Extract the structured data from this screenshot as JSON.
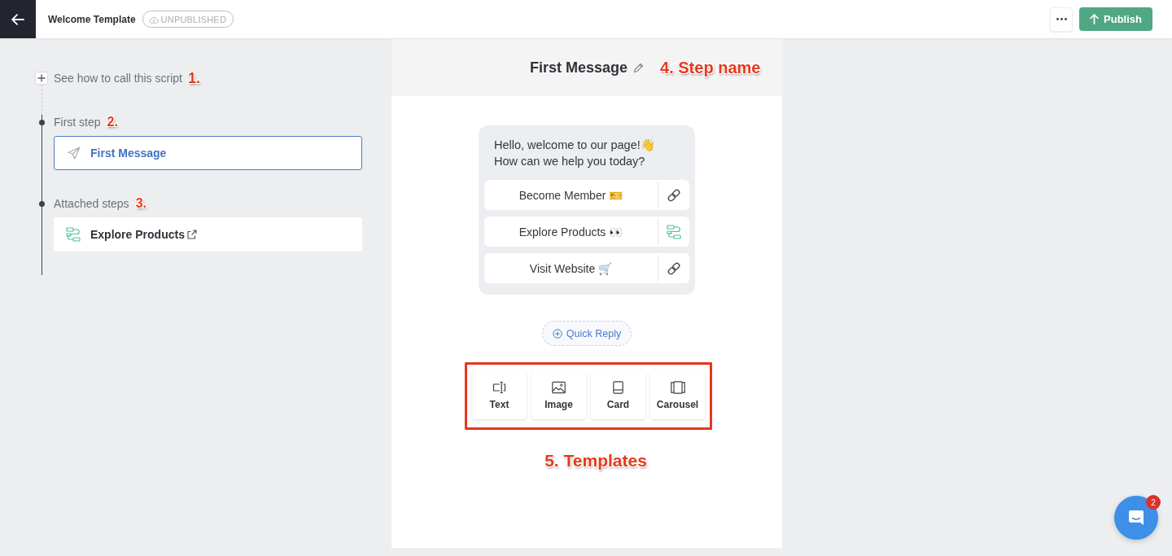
{
  "topbar": {
    "title": "Welcome Template",
    "status": "UNPUBLISHED",
    "publish_button": "Publish"
  },
  "sidebar": {
    "script_link": {
      "label": "See how to call this script",
      "annotation": "1."
    },
    "sections": [
      {
        "heading": "First step",
        "annotation": "2.",
        "steps": [
          {
            "name": "First Message",
            "kind": "message",
            "selected": true,
            "external": false
          }
        ]
      },
      {
        "heading": "Attached steps",
        "annotation": "3.",
        "steps": [
          {
            "name": "Explore Products",
            "kind": "flow",
            "selected": false,
            "external": true
          }
        ]
      }
    ]
  },
  "editor": {
    "step_name": "First Message",
    "annotation": "4. Step name",
    "message": {
      "lines": [
        "Hello, welcome to our page!👋",
        "How can we help you today?"
      ],
      "buttons": [
        {
          "label": "Become Member 🎫",
          "kind": "link"
        },
        {
          "label": "Explore Products 👀",
          "kind": "flow"
        },
        {
          "label": "Visit Website 🛒",
          "kind": "link"
        }
      ]
    },
    "quick_reply": "Quick Reply",
    "templates": {
      "annotation": "5. Templates",
      "items": [
        {
          "label": "Text",
          "kind": "text"
        },
        {
          "label": "Image",
          "kind": "image"
        },
        {
          "label": "Card",
          "kind": "card"
        },
        {
          "label": "Carousel",
          "kind": "carousel"
        }
      ]
    }
  },
  "chat_launcher": {
    "badge": "2"
  }
}
